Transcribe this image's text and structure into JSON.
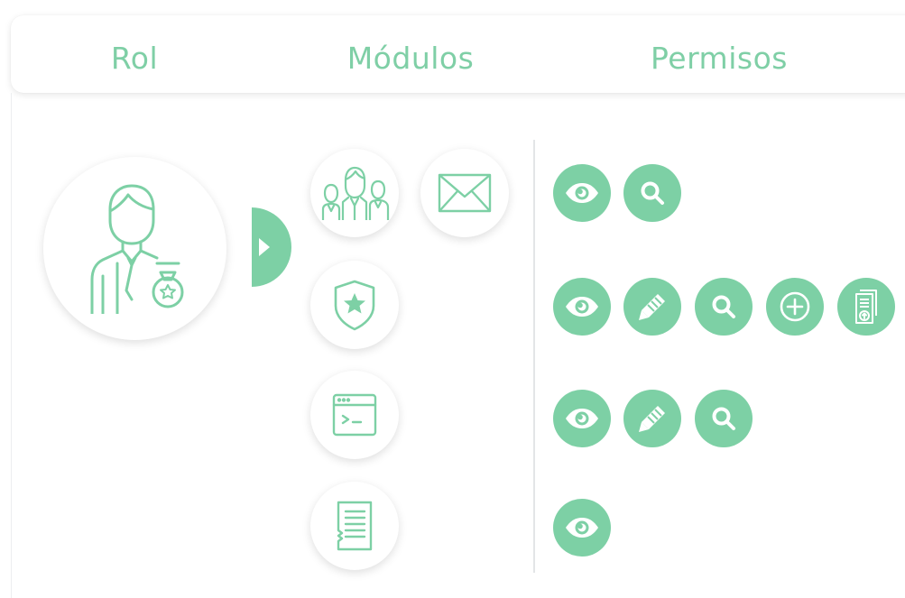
{
  "header": {
    "columns": [
      "Rol",
      "Módulos",
      "Permisos"
    ]
  },
  "colors": {
    "accent": "#7dd0a5",
    "header_text": "#7fcfa6",
    "divider": "#e3e5e7"
  },
  "role": {
    "icon": "manager-with-medal-icon"
  },
  "modules": [
    {
      "icon": "users-group-icon",
      "permissions": [
        "eye-icon",
        "search-icon"
      ]
    },
    {
      "icon": "envelope-icon",
      "permissions": []
    },
    {
      "icon": "shield-star-icon",
      "permissions": [
        "eye-icon",
        "pencil-icon",
        "search-icon",
        "add-circle-icon",
        "document-upload-icon"
      ]
    },
    {
      "icon": "terminal-window-icon",
      "permissions": [
        "eye-icon",
        "pencil-icon",
        "search-icon"
      ]
    },
    {
      "icon": "receipt-icon",
      "permissions": [
        "eye-icon"
      ]
    }
  ]
}
